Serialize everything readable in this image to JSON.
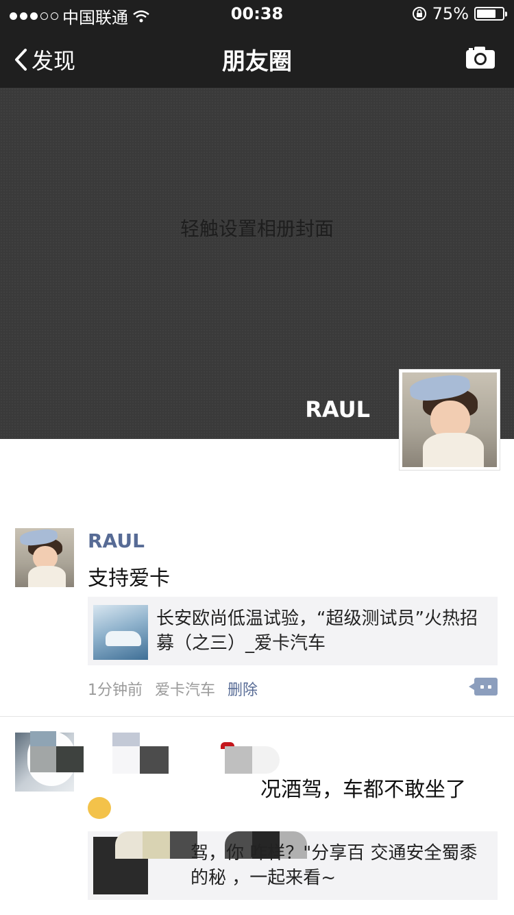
{
  "status_bar": {
    "carrier": "中国联通",
    "time": "00:38",
    "battery_percent": "75%",
    "battery_level": 0.75,
    "signal_bars_filled": 3,
    "signal_bars_total": 5
  },
  "nav": {
    "back_label": "发现",
    "title": "朋友圈",
    "camera_icon": "camera-icon"
  },
  "cover": {
    "hint": "轻触设置相册封面",
    "user_name": "RAUL"
  },
  "posts": [
    {
      "author": "RAUL",
      "text": "支持爱卡",
      "link_title": "长安欧尚低温试验，“超级测试员”火热招募（之三）_爱卡汽车",
      "time": "1分钟前",
      "source": "爱卡汽车",
      "delete_label": "删除"
    },
    {
      "text_visible": "况酒驾，车都不敢坐了",
      "link_title_visible": "驾，你     咋样？\"分享百 交通安全蜀黍 的秘     ，一起来看~"
    }
  ],
  "colors": {
    "nav_bg": "#1f1f1f",
    "cover_bg": "#3a3a3a",
    "link_blue": "#576b95",
    "card_bg": "#f3f3f5"
  }
}
